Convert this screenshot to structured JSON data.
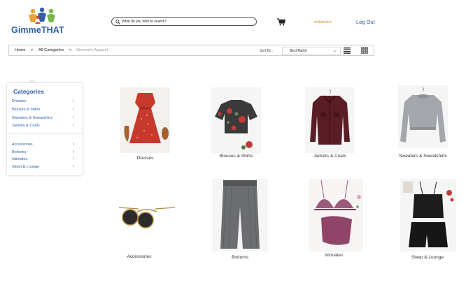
{
  "header": {
    "logo_text": "GimmeTHAT",
    "search_placeholder": "What do you wish to search?",
    "username": "nicbencho",
    "logout_label": "Log Out"
  },
  "breadcrumb": {
    "home": "Home",
    "sep": ">",
    "all_categories": "All Categories",
    "current": "Women's Apparel"
  },
  "sort": {
    "label": "Sort By :",
    "selected": "Best Match"
  },
  "sidebar": {
    "title": "Categories",
    "group1": [
      "Dresses",
      "Blouses & Shirts",
      "Sweaters & Sweatshirts",
      "Jackets & Coats"
    ],
    "group2": [
      "Accessories",
      "Bottoms",
      "Intimates",
      "Sleep & Lounge"
    ]
  },
  "products": [
    {
      "label": "Dresses"
    },
    {
      "label": "Blouses & Shirts"
    },
    {
      "label": "Jackets & Coats"
    },
    {
      "label": "Sweaters & Sweatshirts"
    },
    {
      "label": "Accessories"
    },
    {
      "label": "Bottoms"
    },
    {
      "label": "Intimates"
    },
    {
      "label": "Sleep & Lounge"
    }
  ],
  "colors": {
    "brand_blue": "#2f5da8",
    "username_orange": "#d4881c"
  }
}
